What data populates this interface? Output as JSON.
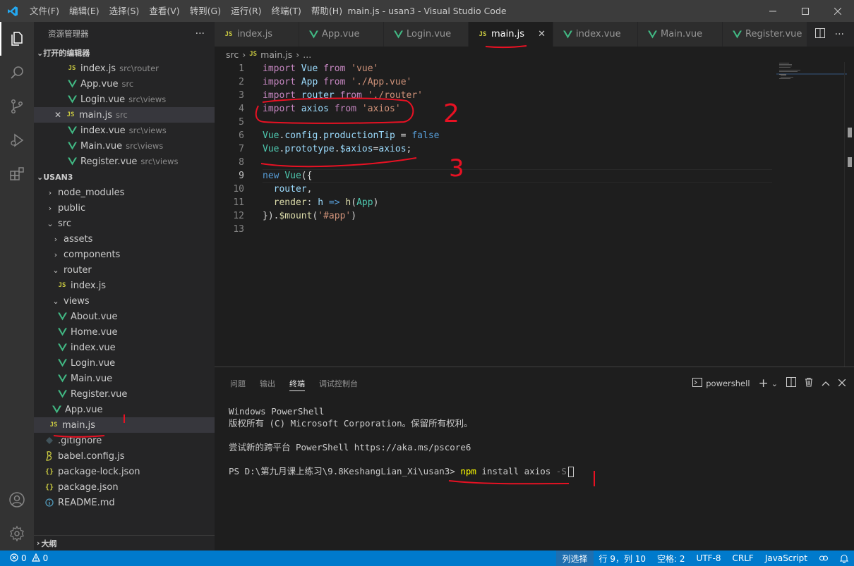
{
  "titlebar": {
    "menu": [
      "文件(F)",
      "编辑(E)",
      "选择(S)",
      "查看(V)",
      "转到(G)",
      "运行(R)",
      "终端(T)",
      "帮助(H)"
    ],
    "title": "main.js - usan3 - Visual Studio Code"
  },
  "sidebar": {
    "title": "资源管理器",
    "more": "···",
    "open_editors_label": "打开的编辑器",
    "open_editors": [
      {
        "name": "index.js",
        "desc": "src\\router",
        "type": "js"
      },
      {
        "name": "App.vue",
        "desc": "src",
        "type": "vue"
      },
      {
        "name": "Login.vue",
        "desc": "src\\views",
        "type": "vue"
      },
      {
        "name": "main.js",
        "desc": "src",
        "type": "js"
      },
      {
        "name": "index.vue",
        "desc": "src\\views",
        "type": "vue"
      },
      {
        "name": "Main.vue",
        "desc": "src\\views",
        "type": "vue"
      },
      {
        "name": "Register.vue",
        "desc": "src\\views",
        "type": "vue"
      }
    ],
    "project_label": "USAN3",
    "tree": {
      "node_modules": "node_modules",
      "public": "public",
      "src": "src",
      "assets": "assets",
      "components": "components",
      "router": "router",
      "router_index": "index.js",
      "views": "views",
      "about": "About.vue",
      "home": "Home.vue",
      "views_index": "index.vue",
      "login": "Login.vue",
      "main_vue": "Main.vue",
      "register": "Register.vue",
      "app": "App.vue",
      "main_js": "main.js",
      "gitignore": ".gitignore",
      "babel": "babel.config.js",
      "package_lock": "package-lock.json",
      "package": "package.json",
      "readme": "README.md"
    },
    "outline_label": "大纲"
  },
  "tabs": [
    {
      "name": "index.js",
      "type": "js"
    },
    {
      "name": "App.vue",
      "type": "vue"
    },
    {
      "name": "Login.vue",
      "type": "vue"
    },
    {
      "name": "main.js",
      "type": "js",
      "active": true
    },
    {
      "name": "index.vue",
      "type": "vue"
    },
    {
      "name": "Main.vue",
      "type": "vue"
    },
    {
      "name": "Register.vue",
      "type": "vue"
    }
  ],
  "breadcrumb": {
    "folder": "src",
    "file": "main.js",
    "more": "..."
  },
  "code": {
    "l1": {
      "kw": "import",
      "id": "Vue",
      "kw2": "from",
      "str": "'vue'"
    },
    "l2": {
      "kw": "import",
      "id": "App",
      "kw2": "from",
      "str": "'./App.vue'"
    },
    "l3": {
      "kw": "import",
      "id": "router",
      "kw2": "from",
      "str": "'./router'"
    },
    "l4": {
      "kw": "import",
      "id": "axios",
      "kw2": "from",
      "str": "'axios'"
    },
    "l6": {
      "cls": "Vue",
      "p1": ".",
      "id1": "config",
      "p2": ".",
      "id2": "productionTip",
      "eq": " = ",
      "val": "false"
    },
    "l7": {
      "cls": "Vue",
      "p1": ".",
      "id1": "prototype",
      "p2": ".",
      "id2": "$axios",
      "eq": "=",
      "id3": "axios",
      "semi": ";"
    },
    "l9": {
      "kw": "new",
      "cls": "Vue",
      "paren": "({"
    },
    "l10": {
      "id": "router",
      "comma": ","
    },
    "l11": {
      "id": "render",
      "colon": ": ",
      "arg": "h",
      "arrow": " => ",
      "fn": "h",
      "p1": "(",
      "cls": "App",
      "p2": ")"
    },
    "l12": {
      "close": "})",
      "dot": ".",
      "fn": "$mount",
      "p1": "(",
      "str": "'#app'",
      "p2": ")"
    }
  },
  "panel": {
    "tabs": [
      "问题",
      "输出",
      "终端",
      "调试控制台"
    ],
    "shell": "powershell",
    "terminal": {
      "line1": "Windows PowerShell",
      "line2": "版权所有 (C) Microsoft Corporation。保留所有权利。",
      "line3": "尝试新的跨平台 PowerShell https://aka.ms/pscore6",
      "prompt": "PS D:\\第九月课上练习\\9.8KeshangLian_Xi\\usan3> ",
      "cmd": "npm",
      "args": " install axios ",
      "flag": "-S"
    }
  },
  "status": {
    "errors": "0",
    "warnings": "0",
    "selection_mode": "列选择",
    "position": "行 9，列 10",
    "spaces": "空格: 2",
    "encoding": "UTF-8",
    "eol": "CRLF",
    "language": "JavaScript"
  },
  "annotations": {
    "two": "2",
    "three": "3"
  },
  "colors": {
    "accent": "#007acc",
    "vue": "#41b883",
    "js": "#cbcb41",
    "annotation": "#e81123"
  }
}
